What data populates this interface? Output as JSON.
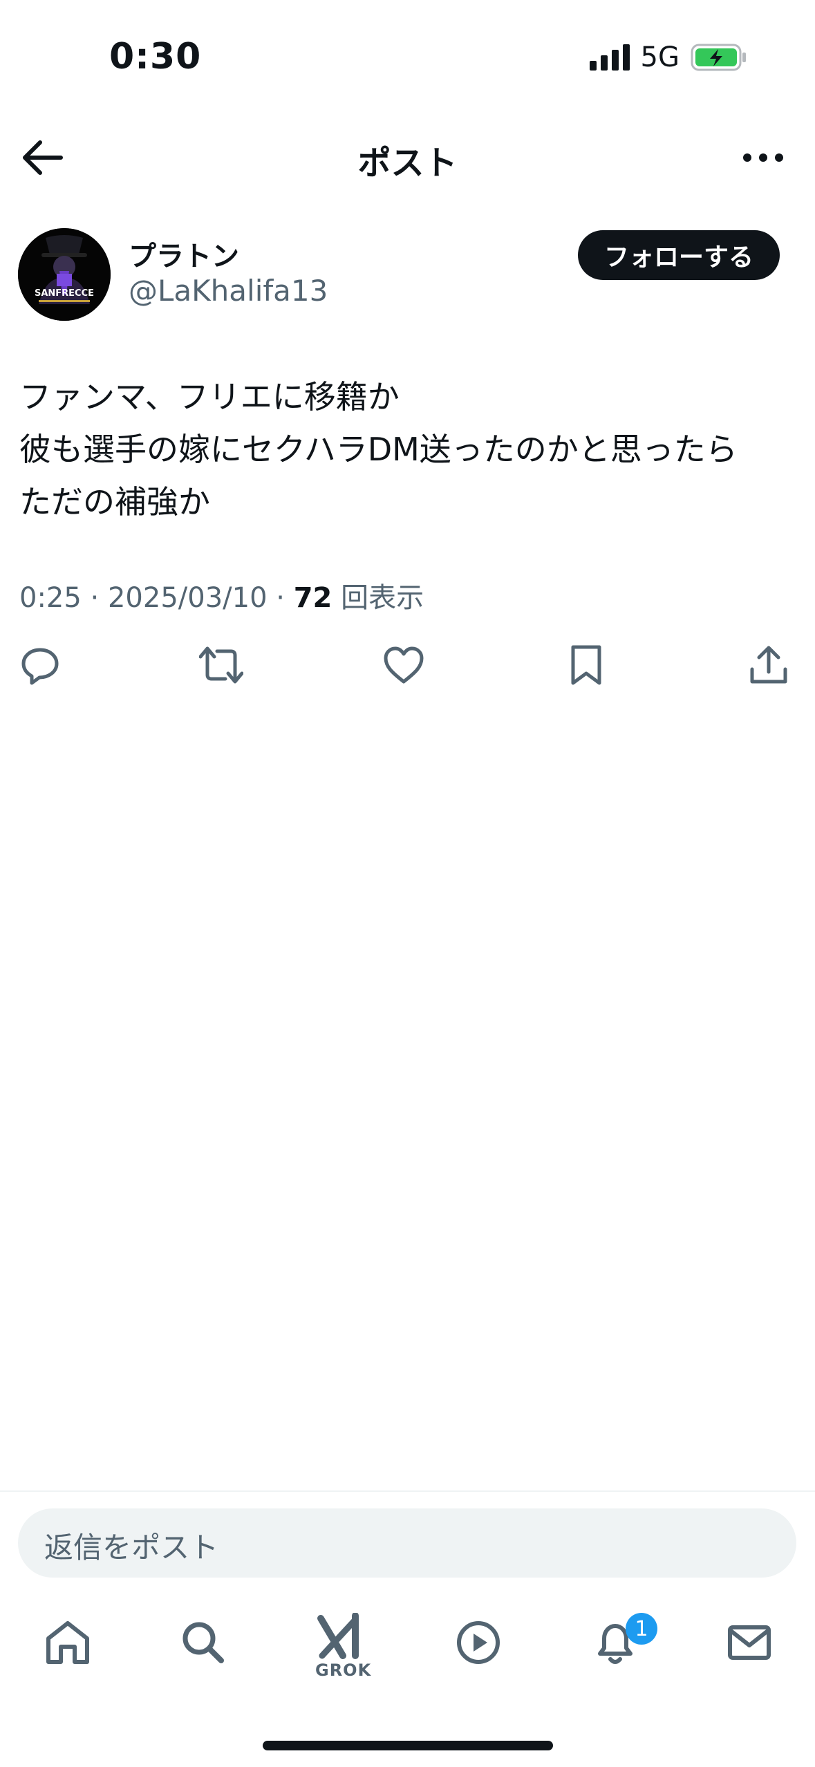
{
  "status_bar": {
    "time": "0:30",
    "network": "5G"
  },
  "header": {
    "title": "ポスト"
  },
  "author": {
    "name": "プラトン",
    "handle": "@LaKhalifa13",
    "avatar_text": "SANFRECCE"
  },
  "follow_button": {
    "label": "フォローする"
  },
  "post": {
    "text": "ファンマ、フリエに移籍か\n彼も選手の嫁にセクハラDM送ったのかと思ったら\nただの補強か",
    "time": "0:25",
    "date": "2025/03/10",
    "views_count": "72",
    "views_label": "回表示"
  },
  "actions": [
    "reply-icon",
    "repost-icon",
    "like-icon",
    "bookmark-icon",
    "share-icon"
  ],
  "reply_bar": {
    "placeholder": "返信をポスト"
  },
  "tab_bar": {
    "grok_label": "GROK",
    "notification_badge": "1"
  },
  "colors": {
    "text": "#0f1419",
    "secondary": "#536471",
    "accent": "#1d9bf0",
    "battery": "#34c759"
  }
}
